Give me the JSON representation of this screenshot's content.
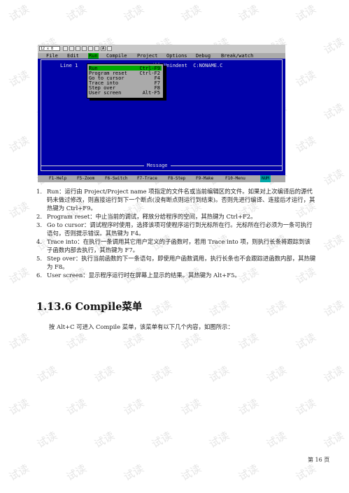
{
  "watermark": "试读",
  "dos": {
    "toolbar_combo": "12 x 8",
    "toolbar_buttons": [
      "A",
      "A"
    ],
    "menu": [
      "File",
      "Edit",
      "Run",
      "Compile",
      "Project",
      "Options",
      "Debug",
      "Break/watch"
    ],
    "menu_selected": "Run",
    "edit_line": "Line 1",
    "edit_right": "Fill Unindent  C:NONAME.C",
    "dropdown": [
      {
        "label": "Run",
        "key": "Ctrl-F9"
      },
      {
        "label": "Program reset",
        "key": "Ctrl-F2"
      },
      {
        "label": "Go to cursor",
        "key": "F4"
      },
      {
        "label": "Trace into",
        "key": "F7"
      },
      {
        "label": "Step over",
        "key": "F8"
      },
      {
        "label": "User screen",
        "key": "Alt-F5"
      }
    ],
    "message_title": "Message",
    "status": [
      "F1-Help",
      "F5-Zoom",
      "F6-Switch",
      "F7-Trace",
      "F8-Step",
      "F9-Make",
      "F10-Menu"
    ],
    "status_num": "NUM"
  },
  "items": [
    {
      "n": "1.",
      "text": "Run：运行由 Project/Project name 项指定的文件名或当前编辑区的文件。如果对上次编译后的源代码未做过修改，则直接运行到下一个断点(没有断点则运行到结束)。否则先进行编译、连接后才运行，其热键为 Ctrl+F9。"
    },
    {
      "n": "2.",
      "text": "Program reset：中止当前的调试，释放分给程序的空间，其热键为 Ctrl+F2。"
    },
    {
      "n": "3.",
      "text": "Go to cursor：调试程序时使用，选择该项可使程序运行到光标所在行。光标所在行必须为一条可执行语句，否则提示错误。其热键为 F4。"
    },
    {
      "n": "4.",
      "text": "Trace into：在执行一条调用其它用户定义的子函数时，若用 Trace into 项，则执行长条将跟踪到该子函数内部去执行，其热键为 F7。"
    },
    {
      "n": "5.",
      "text": "Step over：执行当前函数的下一条语句，即使用户函数调用，执行长条也不会跟踪进函数内部，其热键为 F8。"
    },
    {
      "n": "6.",
      "text": "User screen：显示程序运行时在屏幕上显示的结果。其热键为 Alt+F5。"
    }
  ],
  "heading": "1.13.6 Compile菜单",
  "paragraph": "按 Alt+C 可进入 Compile 菜单，该菜单有以下几个内容，如图所示：",
  "page_number": "第 16 页"
}
